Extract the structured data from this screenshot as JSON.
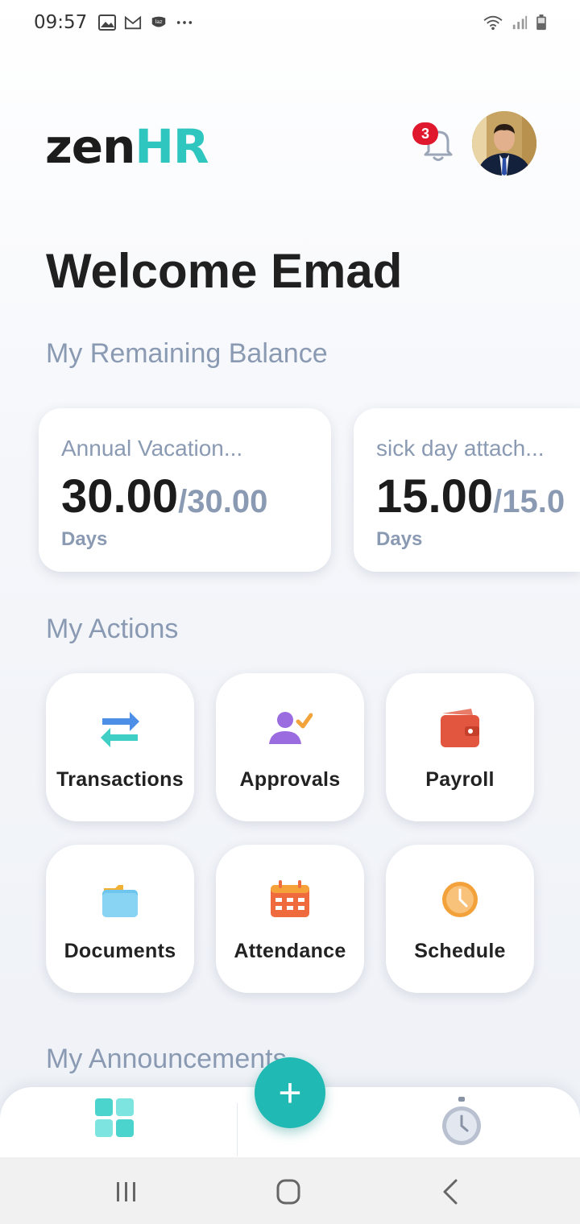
{
  "status_bar": {
    "time": "09:57",
    "notification_icons": [
      "image-icon",
      "gmail-icon",
      "lazada-icon",
      "more-dots-icon"
    ],
    "right_icons": [
      "wifi-icon",
      "signal-icon",
      "battery-icon"
    ]
  },
  "header": {
    "logo_part1": "zen",
    "logo_part2": "HR",
    "notification_count": "3",
    "avatar_icon": "profile-photo"
  },
  "welcome_text": "Welcome Emad",
  "balance": {
    "section_title": "My Remaining Balance",
    "cards": [
      {
        "name": "Annual Vacation...",
        "remaining": "30.00",
        "total": "/30.00",
        "unit": "Days"
      },
      {
        "name": "sick day attach...",
        "remaining": "15.00",
        "total": "/15.0",
        "unit": "Days"
      }
    ]
  },
  "actions": {
    "section_title": "My Actions",
    "items": [
      {
        "label": "Transactions",
        "icon": "transactions-icon"
      },
      {
        "label": "Approvals",
        "icon": "approvals-icon"
      },
      {
        "label": "Payroll",
        "icon": "wallet-icon"
      },
      {
        "label": "Documents",
        "icon": "folder-icon"
      },
      {
        "label": "Attendance",
        "icon": "calendar-icon"
      },
      {
        "label": "Schedule",
        "icon": "clock-icon"
      }
    ]
  },
  "announcements": {
    "section_title": "My Announcements"
  },
  "tab_bar": {
    "fab_label": "+",
    "tabs": [
      "home-grid-icon",
      "stopwatch-icon"
    ]
  },
  "colors": {
    "brand_teal": "#2fc6c0",
    "badge_red": "#e0182d",
    "muted_text": "#8a9ab3"
  }
}
